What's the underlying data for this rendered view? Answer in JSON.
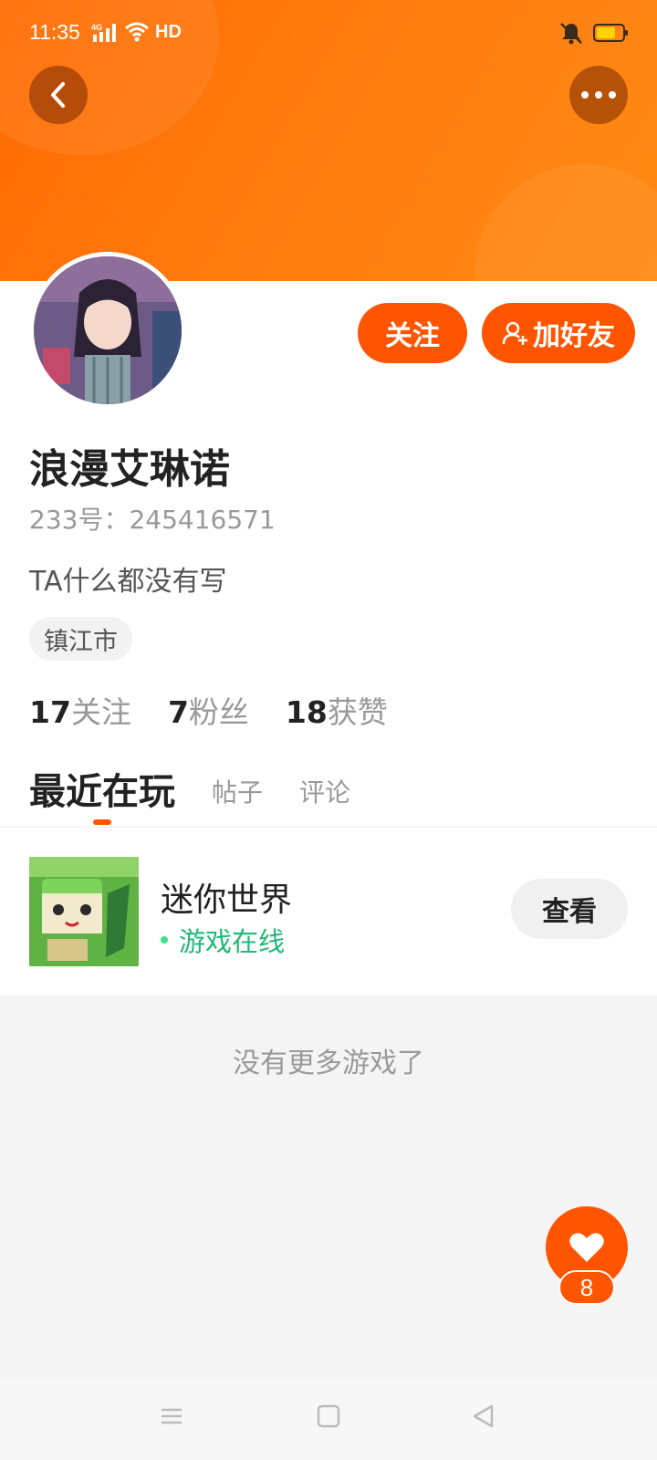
{
  "status_bar": {
    "time": "11:35",
    "network": "4G",
    "hd": "HD",
    "icons": [
      "signal-icon",
      "wifi-icon",
      "mute-bell-icon",
      "battery-icon"
    ]
  },
  "header": {
    "back_icon": "chevron-left-icon",
    "more_icon": "more-dots-icon",
    "accent": "#ff5500"
  },
  "profile": {
    "name": "浪漫艾琳诺",
    "uid": "233号：245416571",
    "bio": "TA什么都没有写",
    "city": "镇江市",
    "follow_label": "关注",
    "add_friend_label": "加好友",
    "stats": [
      {
        "num": "17",
        "label": "关注"
      },
      {
        "num": "7",
        "label": "粉丝"
      },
      {
        "num": "18",
        "label": "获赞"
      }
    ]
  },
  "tabs": [
    {
      "label": "最近在玩",
      "active": true
    },
    {
      "label": "帖子",
      "active": false
    },
    {
      "label": "评论",
      "active": false
    }
  ],
  "games": [
    {
      "name": "迷你世界",
      "status": "游戏在线",
      "action": "查看"
    }
  ],
  "list_footer": "没有更多游戏了",
  "like": {
    "count": "8"
  }
}
